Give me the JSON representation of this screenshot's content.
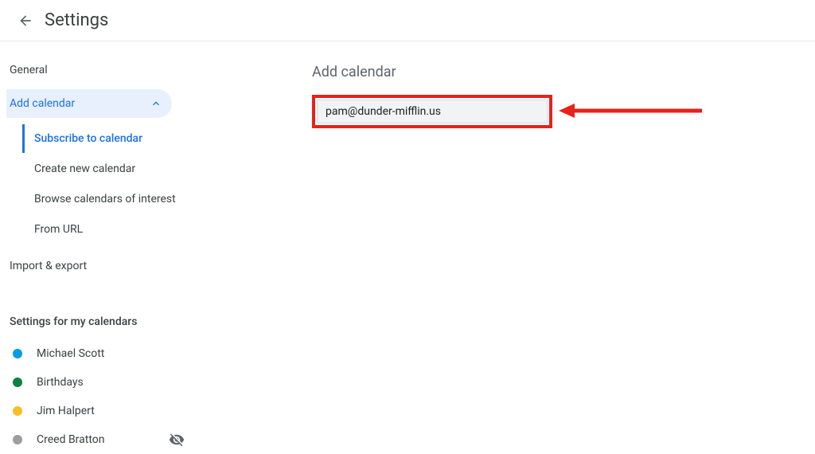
{
  "header": {
    "title": "Settings"
  },
  "sidebar": {
    "general": "General",
    "add_calendar": {
      "label": "Add calendar",
      "items": [
        "Subscribe to calendar",
        "Create new calendar",
        "Browse calendars of interest",
        "From URL"
      ]
    },
    "import_export": "Import & export",
    "my_cal_heading": "Settings for my calendars",
    "calendars": [
      {
        "name": "Michael Scott",
        "color": "#039be5",
        "hidden": false
      },
      {
        "name": "Birthdays",
        "color": "#0b8043",
        "hidden": false
      },
      {
        "name": "Jim Halpert",
        "color": "#f6bf26",
        "hidden": false
      },
      {
        "name": "Creed Bratton",
        "color": "#9e9e9e",
        "hidden": true
      }
    ]
  },
  "main": {
    "title": "Add calendar",
    "input_value": "pam@dunder-mifflin.us"
  },
  "annotation": {
    "highlight_color": "#e8211a"
  }
}
